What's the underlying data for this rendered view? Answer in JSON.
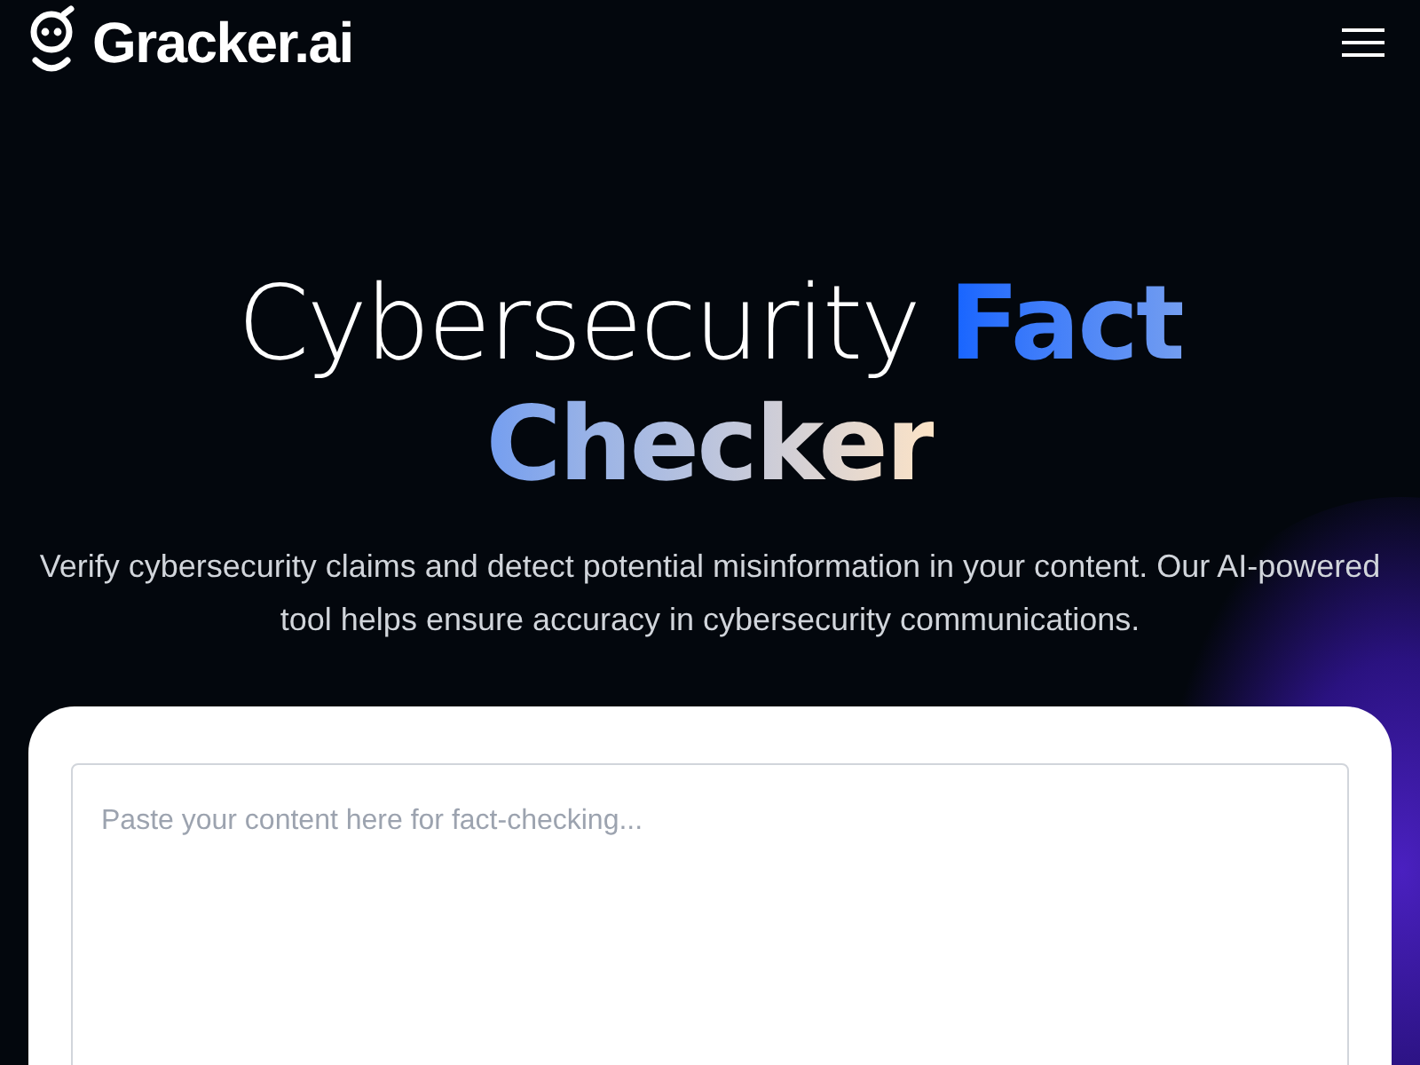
{
  "header": {
    "logo_text": "Gracker.ai"
  },
  "hero": {
    "title_plain": "Cybersecurity",
    "title_highlight": "Fact Checker",
    "subtitle": "Verify cybersecurity claims and detect potential misinformation in your content. Our AI-powered tool helps ensure accuracy in cybersecurity communications."
  },
  "checker": {
    "placeholder": "Paste your content here for fact-checking..."
  }
}
